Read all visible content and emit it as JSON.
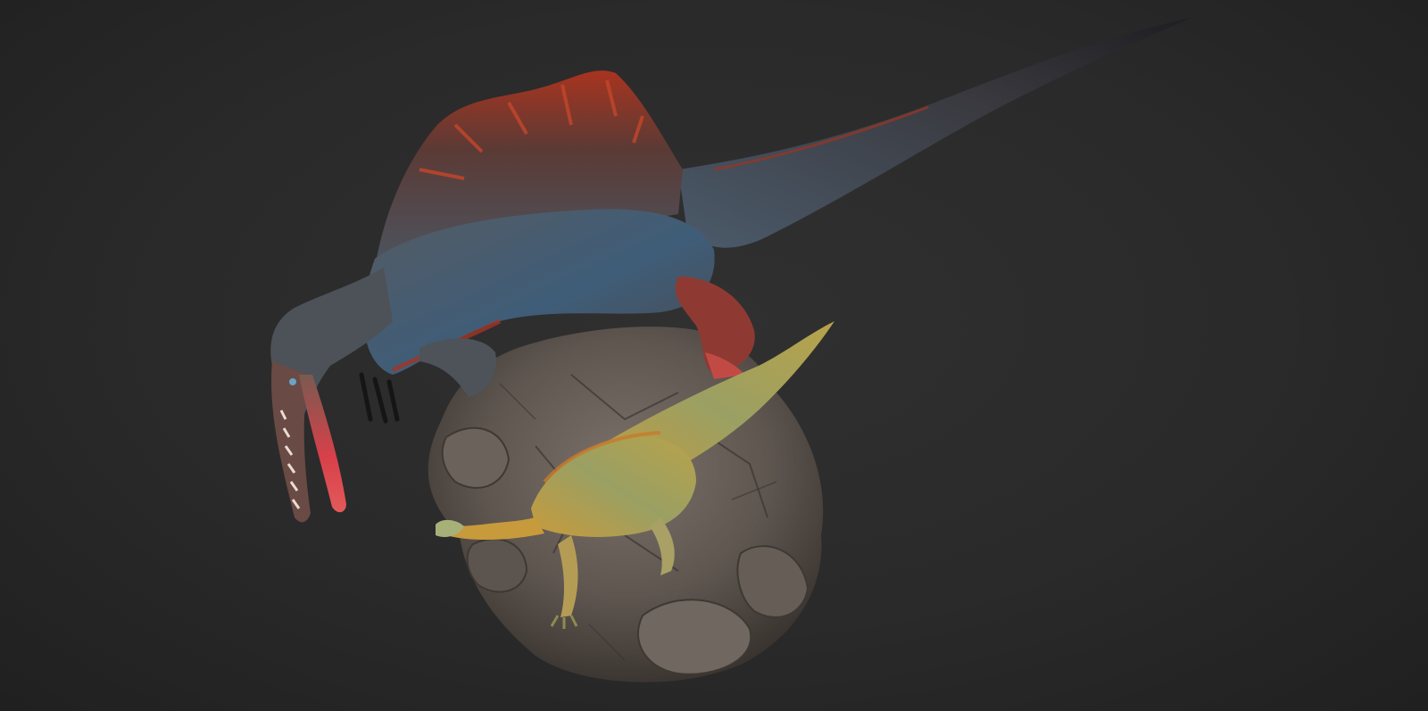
{
  "scene": {
    "background_color": "#2a2a2a",
    "subjects": [
      "spinosaurus",
      "iguanodont",
      "rock-base"
    ],
    "palette": {
      "rock": "#6b625b",
      "rock_dark": "#3e3833",
      "spino_body": "#4a5158",
      "spino_blue": "#3f5d78",
      "spino_red": "#b23a26",
      "spino_snout": "#d8404a",
      "small_dino_yellow": "#c79a3c",
      "small_dino_green": "#8a9a63"
    }
  }
}
